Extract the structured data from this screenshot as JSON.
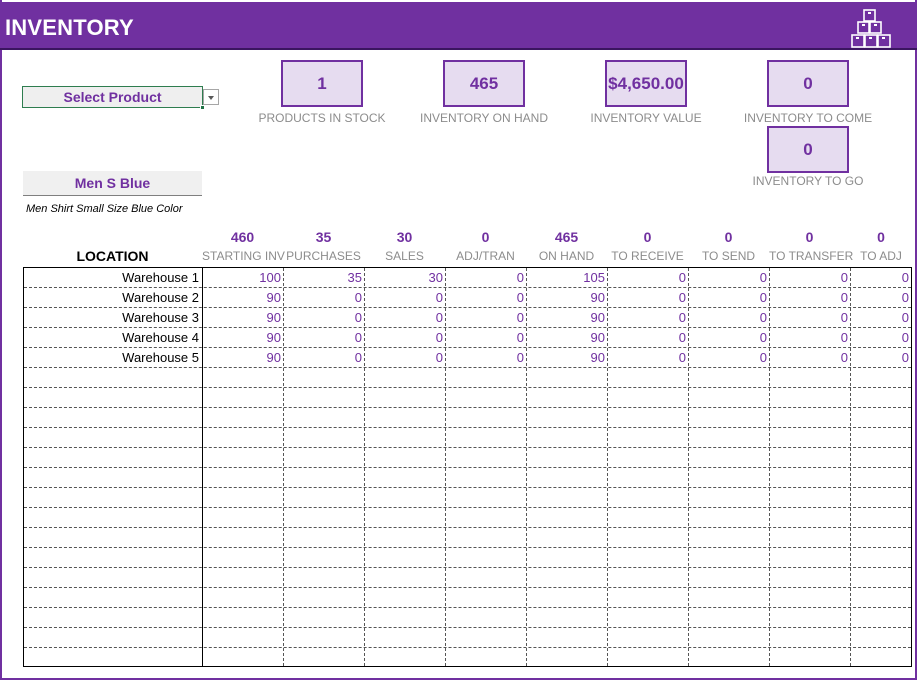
{
  "header": {
    "title": "INVENTORY",
    "logo_icon": "stacked-boxes-icon"
  },
  "selector": {
    "label": "Select Product",
    "dropdown_icon": "chevron-down-icon"
  },
  "kpis": {
    "products_in_stock": {
      "value": "1",
      "label": "PRODUCTS IN STOCK"
    },
    "inventory_on_hand": {
      "value": "465",
      "label": "INVENTORY ON HAND"
    },
    "inventory_value": {
      "value": "$4,650.00",
      "label": "INVENTORY VALUE"
    },
    "inventory_to_come": {
      "value": "0",
      "label": "INVENTORY TO COME"
    },
    "inventory_to_go": {
      "value": "0",
      "label": "INVENTORY TO GO"
    }
  },
  "product": {
    "name": "Men S Blue",
    "description": "Men Shirt Small Size Blue Color"
  },
  "table": {
    "location_header": "LOCATION",
    "columns": [
      {
        "label": "STARTING INV",
        "total": "460"
      },
      {
        "label": "PURCHASES",
        "total": "35"
      },
      {
        "label": "SALES",
        "total": "30"
      },
      {
        "label": "ADJ/TRAN",
        "total": "0"
      },
      {
        "label": "ON HAND",
        "total": "465"
      },
      {
        "label": "TO RECEIVE",
        "total": "0"
      },
      {
        "label": "TO SEND",
        "total": "0"
      },
      {
        "label": "TO TRANSFER",
        "total": "0"
      },
      {
        "label": "TO ADJ",
        "total": "0"
      }
    ],
    "rows": [
      {
        "location": "Warehouse 1",
        "values": [
          "100",
          "35",
          "30",
          "0",
          "105",
          "0",
          "0",
          "0",
          "0"
        ]
      },
      {
        "location": "Warehouse 2",
        "values": [
          "90",
          "0",
          "0",
          "0",
          "90",
          "0",
          "0",
          "0",
          "0"
        ]
      },
      {
        "location": "Warehouse 3",
        "values": [
          "90",
          "0",
          "0",
          "0",
          "90",
          "0",
          "0",
          "0",
          "0"
        ]
      },
      {
        "location": "Warehouse 4",
        "values": [
          "90",
          "0",
          "0",
          "0",
          "90",
          "0",
          "0",
          "0",
          "0"
        ]
      },
      {
        "location": "Warehouse 5",
        "values": [
          "90",
          "0",
          "0",
          "0",
          "90",
          "0",
          "0",
          "0",
          "0"
        ]
      }
    ]
  },
  "colors": {
    "accent": "#7030a0",
    "accent_light": "#e6dcf0",
    "label_gray": "#8c8c8c"
  }
}
